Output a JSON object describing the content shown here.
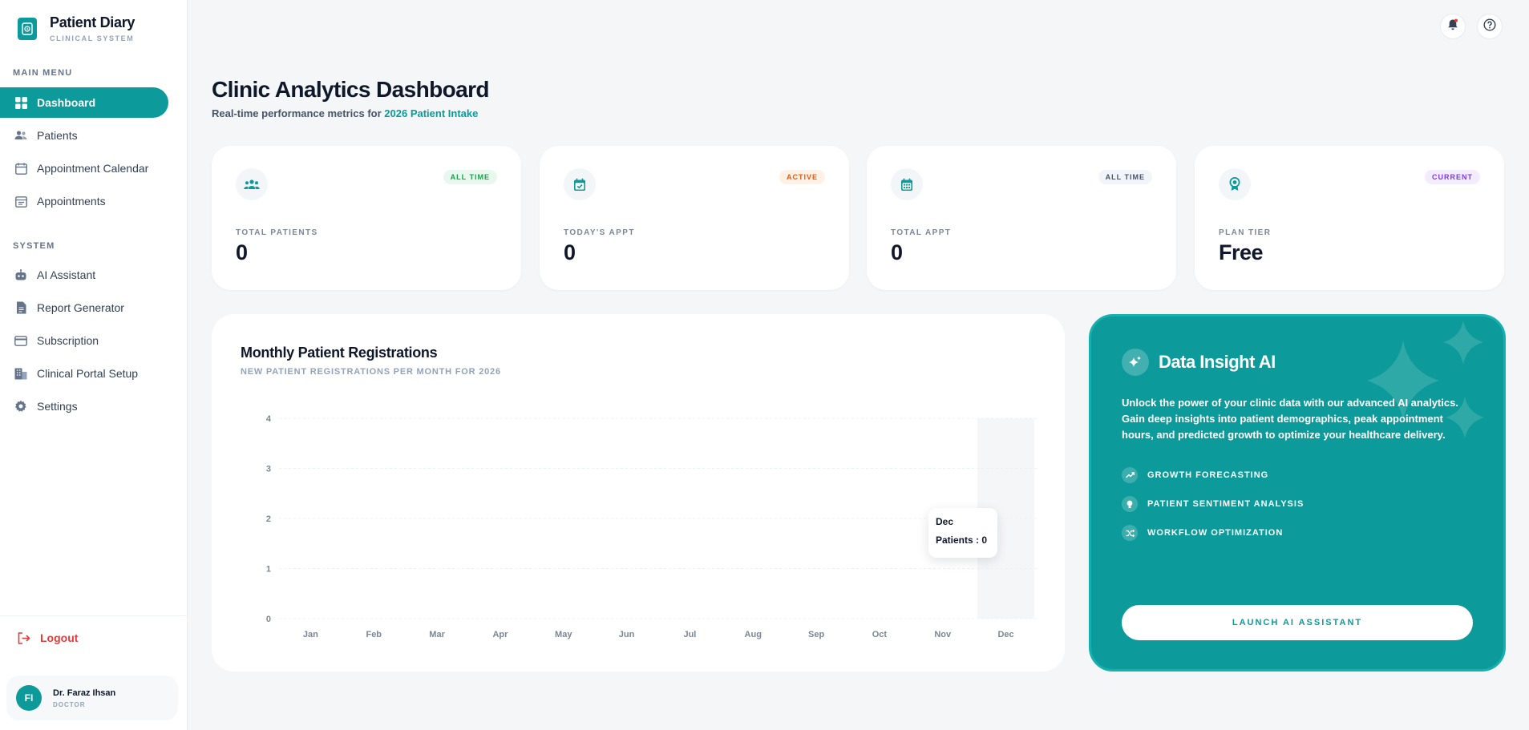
{
  "brand": {
    "title": "Patient Diary",
    "subtitle": "CLINICAL SYSTEM"
  },
  "sidebar": {
    "main_label": "MAIN MENU",
    "main_items": [
      {
        "label": "Dashboard",
        "icon": "grid-icon",
        "active": true
      },
      {
        "label": "Patients",
        "icon": "users-icon"
      },
      {
        "label": "Appointment Calendar",
        "icon": "calendar-icon"
      },
      {
        "label": "Appointments",
        "icon": "clipboard-icon"
      }
    ],
    "system_label": "SYSTEM",
    "system_items": [
      {
        "label": "AI Assistant",
        "icon": "robot-icon"
      },
      {
        "label": "Report Generator",
        "icon": "document-icon"
      },
      {
        "label": "Subscription",
        "icon": "credit-card-icon"
      },
      {
        "label": "Clinical Portal Setup",
        "icon": "building-icon"
      },
      {
        "label": "Settings",
        "icon": "gear-icon"
      }
    ],
    "logout": "Logout"
  },
  "user": {
    "initials": "FI",
    "name": "Dr. Faraz Ihsan",
    "role": "DOCTOR"
  },
  "header": {
    "title": "Clinic Analytics Dashboard",
    "subtitle_prefix": "Real-time performance metrics for ",
    "subtitle_highlight": "2026 Patient Intake"
  },
  "stats": [
    {
      "label": "TOTAL PATIENTS",
      "value": "0",
      "badge": "ALL TIME",
      "badge_color": "#16a34a",
      "badge_bg": "#e8f8ee",
      "icon": "users-icon"
    },
    {
      "label": "TODAY'S APPT",
      "value": "0",
      "badge": "ACTIVE",
      "badge_color": "#ea580c",
      "badge_bg": "#fff1e6",
      "icon": "calendar-check-icon"
    },
    {
      "label": "TOTAL APPT",
      "value": "0",
      "badge": "ALL TIME",
      "badge_color": "#475569",
      "badge_bg": "#f1f5f9",
      "icon": "calendar-grid-icon"
    },
    {
      "label": "PLAN TIER",
      "value": "Free",
      "badge": "CURRENT",
      "badge_color": "#7c3aed",
      "badge_bg": "#f3ecff",
      "icon": "award-icon"
    }
  ],
  "chart": {
    "title": "Monthly Patient Registrations",
    "subtitle": "NEW PATIENT REGISTRATIONS PER MONTH FOR 2026",
    "tooltip_month": "Dec",
    "tooltip_text": "Patients : 0"
  },
  "chart_data": {
    "type": "bar",
    "categories": [
      "Jan",
      "Feb",
      "Mar",
      "Apr",
      "May",
      "Jun",
      "Jul",
      "Aug",
      "Sep",
      "Oct",
      "Nov",
      "Dec"
    ],
    "values": [
      0,
      0,
      0,
      0,
      0,
      0,
      0,
      0,
      0,
      0,
      0,
      0
    ],
    "title": "Monthly Patient Registrations",
    "yticks": [
      0,
      1,
      2,
      3,
      4
    ],
    "ylim": [
      0,
      4
    ],
    "grid": true,
    "highlighted_category": "Dec"
  },
  "ai": {
    "title": "Data Insight AI",
    "description": "Unlock the power of your clinic data with our advanced AI analytics. Gain deep insights into patient demographics, peak appointment hours, and predicted growth to optimize your healthcare delivery.",
    "features": [
      {
        "label": "GROWTH FORECASTING",
        "icon": "trend-up-icon"
      },
      {
        "label": "PATIENT SENTIMENT ANALYSIS",
        "icon": "bulb-icon"
      },
      {
        "label": "WORKFLOW OPTIMIZATION",
        "icon": "shuffle-icon"
      }
    ],
    "button": "LAUNCH AI ASSISTANT"
  },
  "colors": {
    "accent": "#0d9a9a",
    "danger": "#e23b3b",
    "text": "#0f172a",
    "muted": "#94a3b8"
  }
}
